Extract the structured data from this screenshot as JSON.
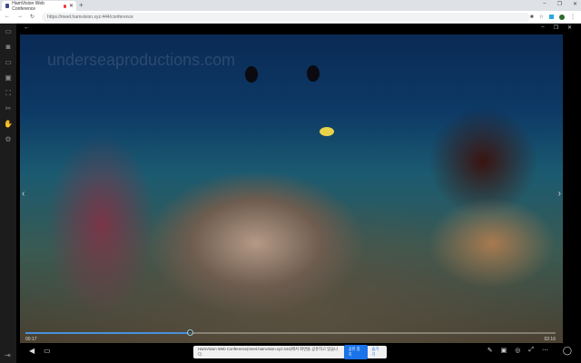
{
  "browser": {
    "tab_title": "HamVision Web Conference",
    "url": "https://meet.hamvision.xyz:444/conference",
    "window_controls": [
      "–",
      "❐",
      "✕"
    ]
  },
  "app": {
    "header_controls": [
      "–",
      "❐",
      "✕"
    ]
  },
  "video": {
    "watermark": "underseaproductions.com",
    "current_time": "00:17",
    "duration": "02:16",
    "progress": 0.31,
    "accent": "#4a90d9"
  },
  "share_bar": {
    "message": "HamVision Web Conference(meet.hamvision.xyz:444)에서 화면을 공유하고 있습니다.",
    "stop_label": "공유 중지",
    "hide_label": "숨기기"
  },
  "sidebar": {
    "icons": [
      "folder-icon",
      "camera-icon",
      "folder-open-icon",
      "monitor-icon",
      "fullscreen-icon",
      "shuffle-icon",
      "hand-icon",
      "settings-icon"
    ]
  }
}
